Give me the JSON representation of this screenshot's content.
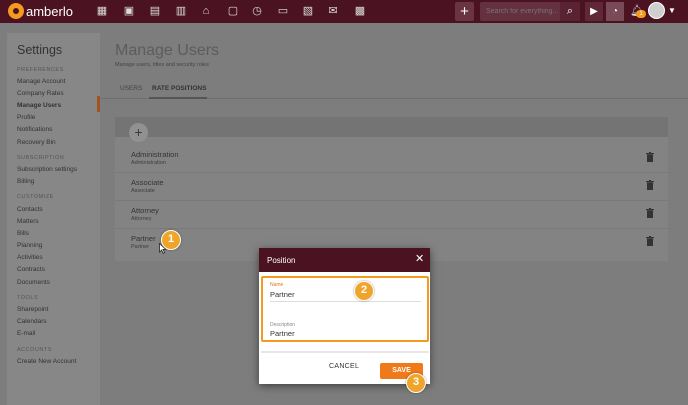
{
  "app": {
    "brand": "amberlo",
    "search_placeholder": "Search for everything...",
    "notification_count": "1",
    "accent": "#f39a1f",
    "header_color": "#4b1322"
  },
  "sidebar": {
    "title": "Settings",
    "sections": [
      {
        "label": "PREFERENCES",
        "items": [
          "Manage Account",
          "Company Rates",
          "Manage Users",
          "Profile",
          "Notifications",
          "Recovery Bin"
        ]
      },
      {
        "label": "SUBSCRIPTION",
        "items": [
          "Subscription settings",
          "Billing"
        ]
      },
      {
        "label": "CUSTOMIZE",
        "items": [
          "Contacts",
          "Matters",
          "Bills",
          "Planning",
          "Activities",
          "Contracts",
          "Documents"
        ]
      },
      {
        "label": "TOOLS",
        "items": [
          "Sharepoint",
          "Calendars",
          "E-mail"
        ]
      },
      {
        "label": "ACCOUNTS",
        "items": [
          "Create New Account"
        ]
      }
    ],
    "active_item": "Manage Users"
  },
  "main": {
    "title": "Manage Users",
    "subtitle": "Manage users, titles and security roles",
    "tabs": [
      {
        "label": "USERS"
      },
      {
        "label": "RATE POSITIONS",
        "active": true
      }
    ],
    "positions": [
      {
        "name": "Administration",
        "sub": "Administration"
      },
      {
        "name": "Associate",
        "sub": "Associate"
      },
      {
        "name": "Attorney",
        "sub": "Attorney"
      },
      {
        "name": "Partner",
        "sub": "Partner"
      }
    ]
  },
  "callouts": [
    "1",
    "2",
    "3"
  ],
  "dialog": {
    "title": "Position",
    "name_label": "Name",
    "name_value": "Partner",
    "description_label": "Description",
    "description_value": "Partner",
    "cancel_label": "CANCEL",
    "save_label": "SAVE"
  }
}
